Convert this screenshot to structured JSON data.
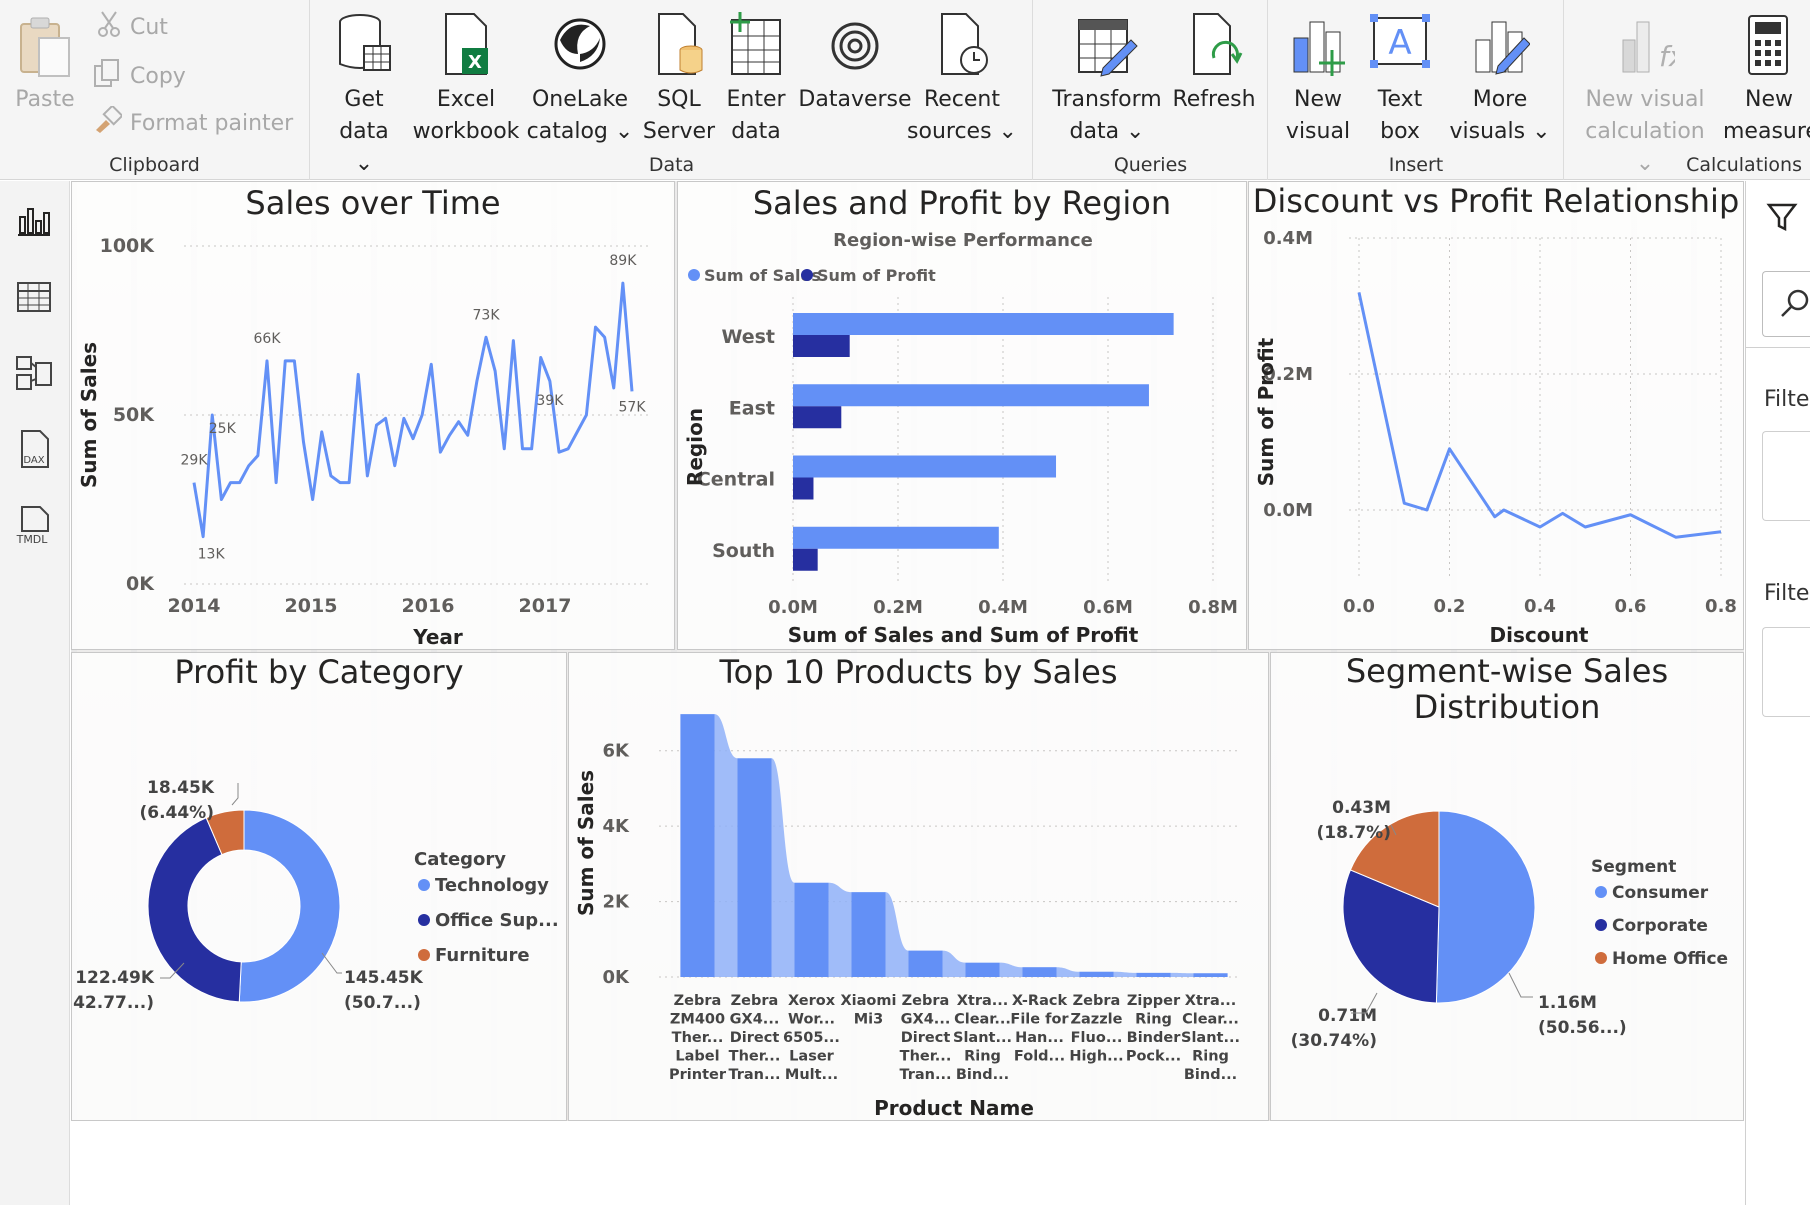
{
  "ribbon": {
    "clipboard": {
      "group_label": "Clipboard",
      "paste": "Paste",
      "cut": "Cut",
      "copy": "Copy",
      "format_painter": "Format painter"
    },
    "data": {
      "group_label": "Data",
      "get_data": [
        "Get",
        "data"
      ],
      "excel": [
        "Excel",
        "workbook"
      ],
      "onelake": [
        "OneLake",
        "catalog"
      ],
      "sql": [
        "SQL",
        "Server"
      ],
      "enter": [
        "Enter",
        "data"
      ],
      "dataverse": [
        "Dataverse"
      ],
      "recent": [
        "Recent",
        "sources"
      ]
    },
    "queries": {
      "group_label": "Queries",
      "transform": [
        "Transform",
        "data"
      ],
      "refresh": [
        "Refresh"
      ]
    },
    "insert": {
      "group_label": "Insert",
      "new_visual": [
        "New",
        "visual"
      ],
      "text_box": [
        "Text",
        "box"
      ],
      "more_visuals": [
        "More",
        "visuals"
      ]
    },
    "calculations": {
      "group_label": "Calculations",
      "new_visual_calc": [
        "New visual",
        "calculation"
      ],
      "new_measure": [
        "New",
        "measure"
      ]
    }
  },
  "left_nav": {
    "items": [
      "report-view-icon",
      "table-view-icon",
      "model-view-icon",
      "dax-query-icon",
      "tmdl-view-icon"
    ],
    "dax_label": "DAX",
    "tmdl_label": "TMDL"
  },
  "filter_pane": {
    "label_1": "Filter",
    "label_2": "Filter"
  },
  "colors": {
    "primary": "#6390f6",
    "secondary": "#262fa0",
    "tertiary": "#cf6c3c"
  },
  "visuals": {
    "sales_over_time": {
      "title": "Sales over Time",
      "chart_data": {
        "type": "line",
        "title": "Sales over Time",
        "xlabel": "Year",
        "ylabel": "Sum of Sales",
        "x_ticks": [
          "2014",
          "2015",
          "2016",
          "2017"
        ],
        "y_ticks": [
          "0K",
          "50K",
          "100K"
        ],
        "ylim": [
          0,
          100000
        ],
        "data_labels": [
          "29K",
          "13K",
          "25K",
          "66K",
          "73K",
          "89K",
          "57K",
          "39K"
        ],
        "values": [
          30000,
          14000,
          50000,
          25000,
          30000,
          30000,
          35000,
          38000,
          66000,
          30000,
          66000,
          66000,
          42000,
          25000,
          45000,
          32000,
          30000,
          30000,
          62000,
          32000,
          47000,
          49000,
          35000,
          49000,
          43000,
          50000,
          65000,
          39000,
          44000,
          48000,
          44000,
          60000,
          73000,
          63000,
          40000,
          72000,
          40000,
          40000,
          67000,
          60000,
          39000,
          40000,
          45000,
          50000,
          76000,
          73000,
          58000,
          89000,
          57000
        ]
      }
    },
    "sales_profit_region": {
      "title": "Sales and Profit by Region",
      "chart_data": {
        "type": "bar",
        "title": "Sales and Profit by Region",
        "subtitle": "Region-wise Performance",
        "xlabel": "Sum of Sales and Sum of Profit",
        "ylabel": "Region",
        "categories": [
          "West",
          "East",
          "Central",
          "South"
        ],
        "x_ticks": [
          "0.0M",
          "0.2M",
          "0.4M",
          "0.6M",
          "0.8M"
        ],
        "xlim": [
          0,
          0.8
        ],
        "series": [
          {
            "name": "Sum of Sales",
            "values": [
              0.725,
              0.678,
              0.501,
              0.392
            ]
          },
          {
            "name": "Sum of Profit",
            "values": [
              0.108,
              0.092,
              0.039,
              0.047
            ]
          }
        ]
      }
    },
    "discount_profit": {
      "title": "Discount vs Profit Relationship",
      "chart_data": {
        "type": "line",
        "title": "Discount vs Profit Relationship",
        "xlabel": "Discount",
        "ylabel": "Sum of Profit",
        "x_ticks": [
          "0.0",
          "0.2",
          "0.4",
          "0.6",
          "0.8"
        ],
        "y_ticks": [
          "0.0M",
          "0.2M",
          "0.4M"
        ],
        "xlim": [
          0,
          0.8
        ],
        "ylim": [
          -0.1,
          0.4
        ],
        "x": [
          0.0,
          0.1,
          0.15,
          0.2,
          0.3,
          0.32,
          0.4,
          0.45,
          0.5,
          0.6,
          0.7,
          0.8
        ],
        "y": [
          0.32,
          0.01,
          0.0,
          0.09,
          -0.01,
          0.0,
          -0.025,
          -0.005,
          -0.025,
          -0.007,
          -0.04,
          -0.032
        ]
      }
    },
    "profit_category": {
      "title": "Profit by Category",
      "chart_data": {
        "type": "pie",
        "title": "Profit by Category",
        "legend_title": "Category",
        "categories": [
          "Technology",
          "Office Sup...",
          "Furniture"
        ],
        "values": [
          145.45,
          122.49,
          18.45
        ],
        "labels": [
          [
            "145.45K",
            "(50.7...)"
          ],
          [
            "122.49K",
            "(42.77...)"
          ],
          [
            "18.45K",
            "(6.44%)"
          ]
        ]
      }
    },
    "top_products": {
      "title": "Top 10 Products by Sales",
      "chart_data": {
        "type": "bar",
        "title": "Top 10 Products by Sales",
        "xlabel": "Product Name",
        "ylabel": "Sum of Sales",
        "y_ticks": [
          "0K",
          "2K",
          "4K",
          "6K"
        ],
        "ylim": [
          0,
          7000
        ],
        "categories": [
          [
            "Zebra",
            "ZM400",
            "Ther...",
            "Label",
            "Printer"
          ],
          [
            "Zebra",
            "GX4...",
            "Direct",
            "Ther...",
            "Tran..."
          ],
          [
            "Xerox",
            "Wor...",
            "6505...",
            "Laser",
            "Mult..."
          ],
          [
            "Xiaomi",
            "Mi3"
          ],
          [
            "Zebra",
            "GX4...",
            "Direct",
            "Ther...",
            "Tran..."
          ],
          [
            "Xtra...",
            "Clear...",
            "Slant...",
            "Ring",
            "Bind..."
          ],
          [
            "X-Rack",
            "File for",
            "Han...",
            "Fold..."
          ],
          [
            "Zebra",
            "Zazzle",
            "Fluo...",
            "High..."
          ],
          [
            "Zipper",
            "Ring",
            "Binder",
            "Pock..."
          ],
          [
            "Xtra...",
            "Clear...",
            "Slant...",
            "Ring",
            "Bind..."
          ]
        ],
        "values": [
          6970,
          5800,
          2500,
          2250,
          700,
          380,
          260,
          140,
          110,
          100
        ]
      }
    },
    "segment_sales": {
      "title_lines": [
        "Segment-wise Sales",
        "Distribution"
      ],
      "chart_data": {
        "type": "pie",
        "title": "Segment-wise Sales Distribution",
        "legend_title": "Segment",
        "categories": [
          "Consumer",
          "Corporate",
          "Home Office"
        ],
        "values": [
          1.16,
          0.71,
          0.43
        ],
        "labels": [
          [
            "1.16M",
            "(50.56...)"
          ],
          [
            "0.71M",
            "(30.74%)"
          ],
          [
            "0.43M",
            "(18.7%)"
          ]
        ]
      }
    }
  }
}
